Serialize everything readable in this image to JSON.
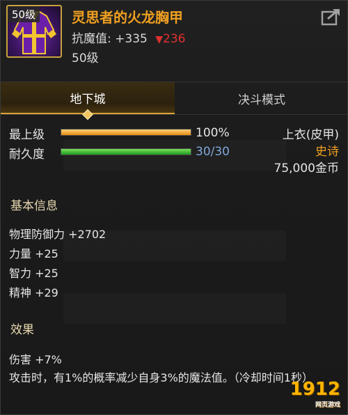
{
  "item": {
    "level_badge": "50级",
    "name": "灵思者的火龙胸甲",
    "resist_label": "抗魔值: +335",
    "resist_down": "236",
    "level_text": "50级"
  },
  "tabs": [
    {
      "label": "地下城",
      "active": true
    },
    {
      "label": "决斗模式",
      "active": false
    }
  ],
  "bars": {
    "grade": {
      "label": "最上级",
      "value": "100%",
      "fill": 1.0
    },
    "durability": {
      "label": "耐久度",
      "value": "30/30",
      "fill": 1.0
    }
  },
  "right_info": {
    "slot": "上衣(皮甲)",
    "rarity": "史诗",
    "price": "75,000金币"
  },
  "basic_info": {
    "title": "基本信息",
    "stats": [
      "物理防御力 +2702",
      "力量 +25",
      "智力 +25",
      "精神 +29"
    ]
  },
  "effects": {
    "title": "效果",
    "lines": [
      "伤害 +7%",
      "攻击时，有1%的概率减少自身3%的魔法值。（冷却时间1秒）"
    ]
  },
  "watermark": {
    "main": "1912",
    "sub": "网页游戏"
  },
  "colors": {
    "title": "#f0a020",
    "epic": "#f0a020",
    "resist_down": "#e03030",
    "accent": "#d9a437"
  }
}
